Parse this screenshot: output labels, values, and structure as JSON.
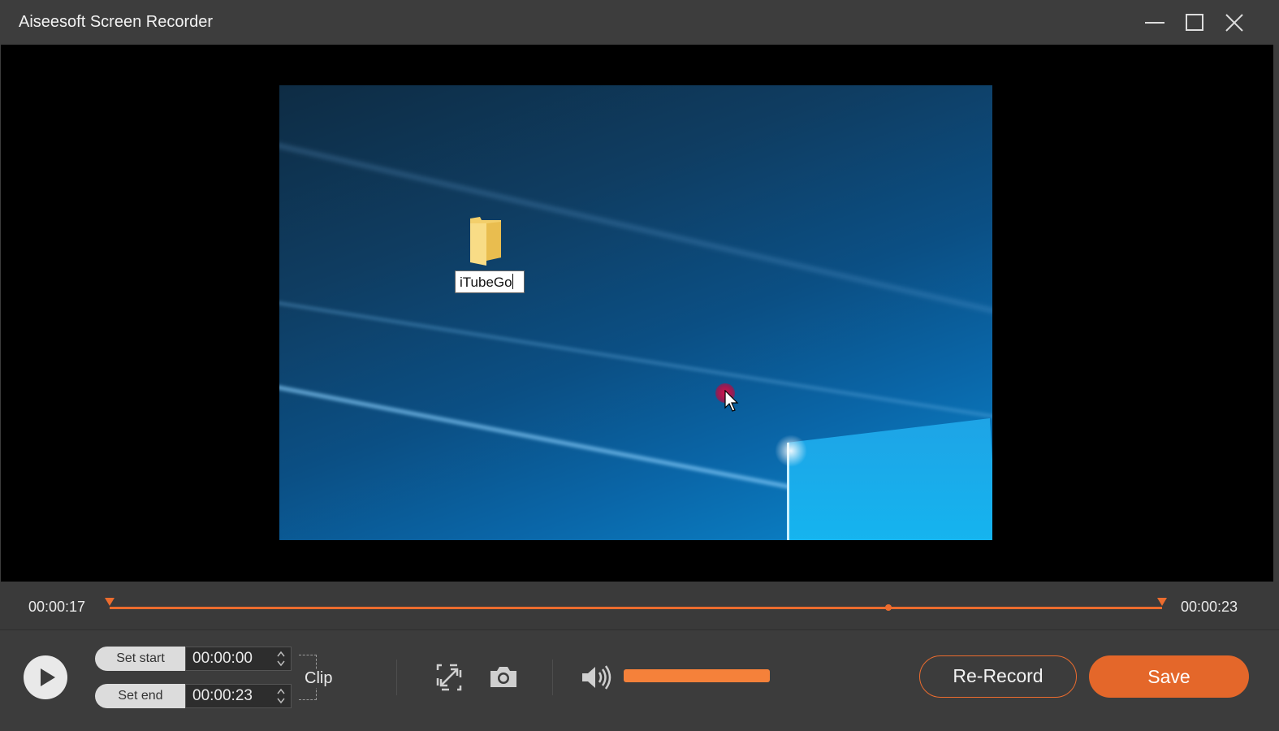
{
  "window": {
    "title": "Aiseesoft Screen Recorder",
    "controls": [
      "minimize-icon",
      "maximize-icon",
      "close-icon"
    ]
  },
  "preview": {
    "desktop_item_label": "iTubeGo",
    "desktop_item_icon": "folder-icon"
  },
  "timeline": {
    "current_time": "00:00:17",
    "total_time": "00:00:23",
    "playhead_fraction": 0.74,
    "accent_color": "#ec6c2e"
  },
  "trim": {
    "set_start_label": "Set start",
    "start_value": "00:00:00",
    "set_end_label": "Set end",
    "end_value": "00:00:23",
    "clip_label": "Clip"
  },
  "tools": {
    "fullscreen_icon": "fullscreen-icon",
    "snapshot_icon": "camera-icon",
    "volume_icon": "speaker-icon",
    "volume_level": 1.0
  },
  "actions": {
    "rerecord_label": "Re-Record",
    "save_label": "Save",
    "save_color": "#e4672a"
  }
}
